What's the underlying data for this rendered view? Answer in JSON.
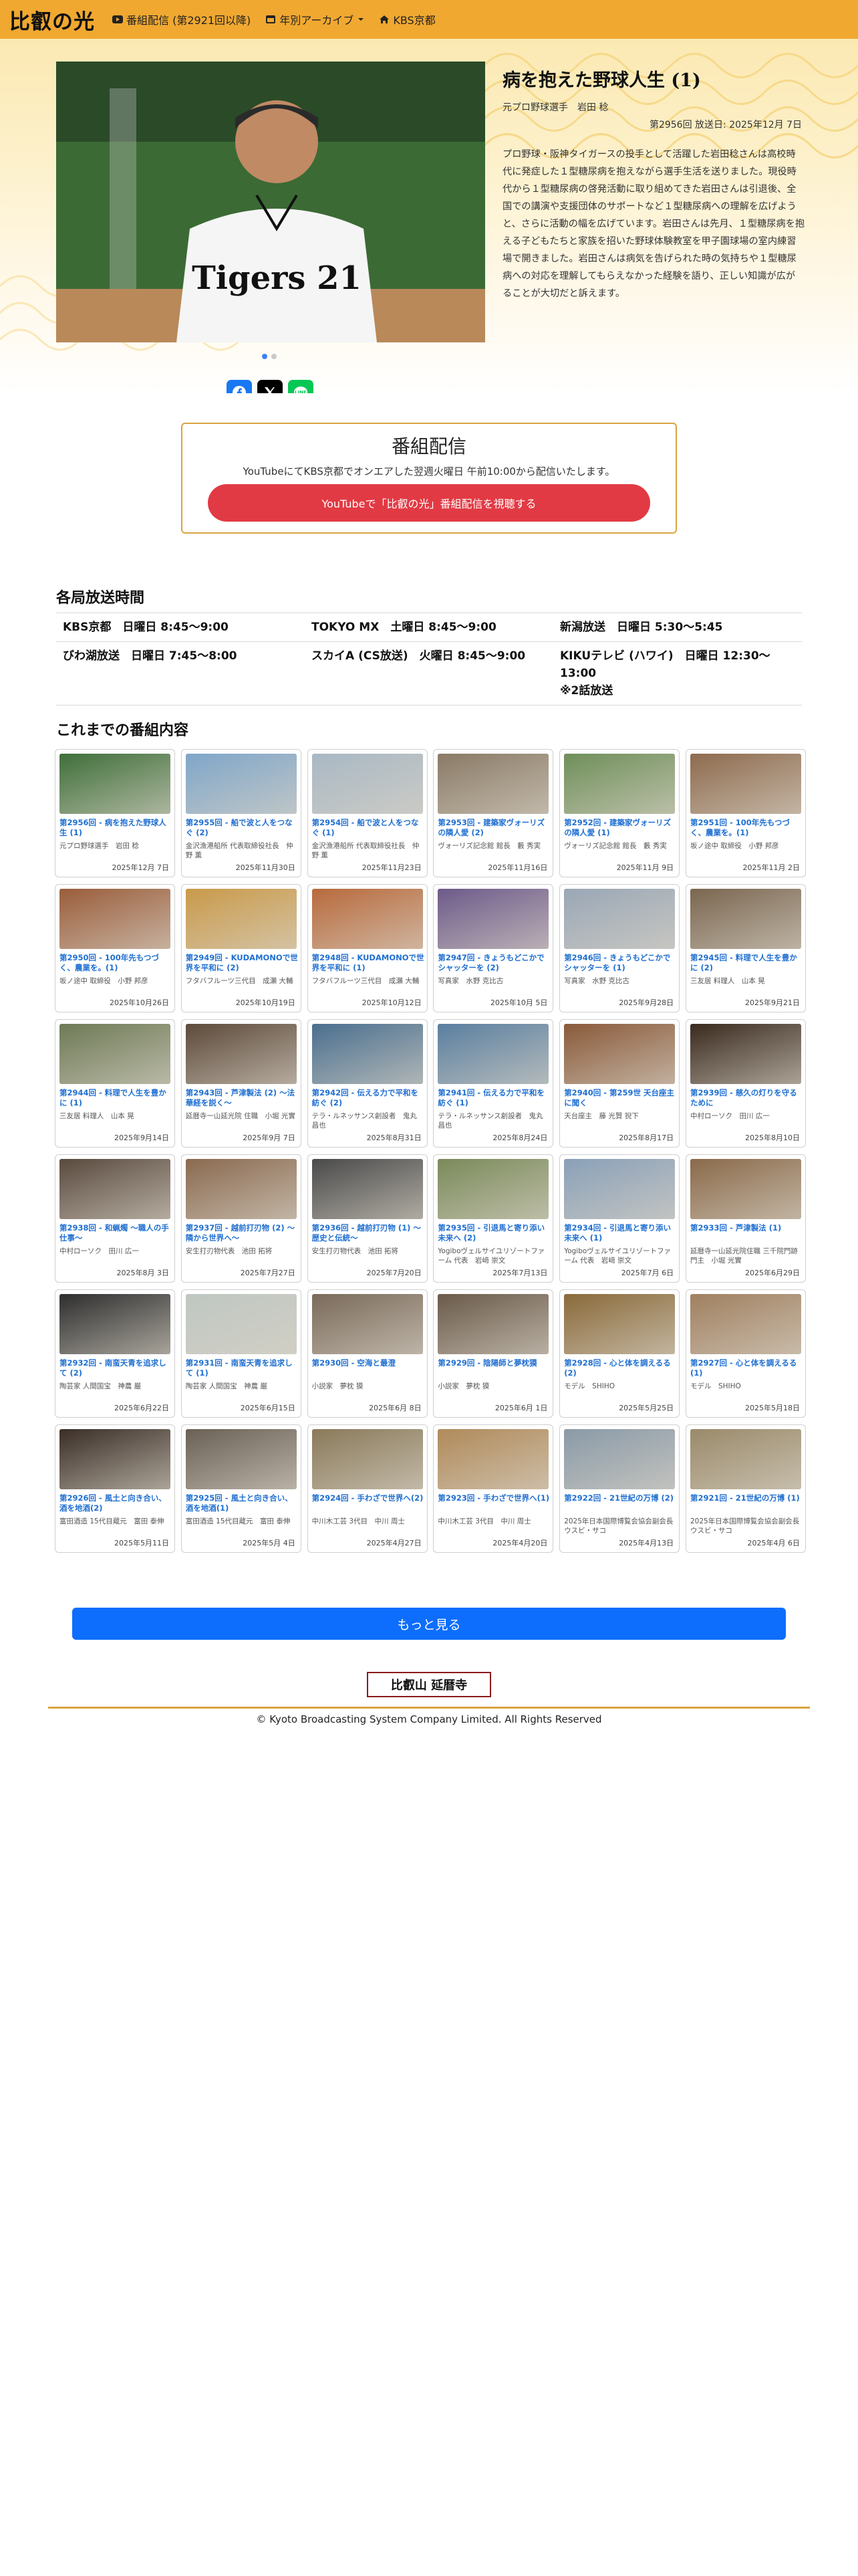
{
  "nav": {
    "brand": "比叡の光",
    "links": [
      {
        "label": "番組配信 (第2921回以降)",
        "icon": "youtube-icon"
      },
      {
        "label": "年別アーカイブ",
        "icon": "calendar-icon"
      },
      {
        "label": "KBS京都",
        "icon": "home-icon"
      }
    ]
  },
  "hero": {
    "title": "病を抱えた野球人生 (1)",
    "guest": "元プロ野球選手　岩田 稔",
    "date": "第2956回 放送日: 2025年12月 7日",
    "description": "プロ野球・阪神タイガースの投手として活躍した岩田稔さんは高校時代に発症した１型糖尿病を抱えながら選手生活を送りました。現役時代から１型糖尿病の啓発活動に取り組めてきた岩田さんは引退後、全国での講演や支援団体のサポートなど１型糖尿病への理解を広げようと、さらに活動の幅を広げています。岩田さんは先月、１型糖尿病を抱える子どもたちと家族を招いた野球体験教室を甲子園球場の室内練習場で開きました。岩田さんは病気を告げられた時の気持ちや１型糖尿病への対応を理解してもらえなかった経験を語り、正しい知識が広がることが大切だと訴えます。",
    "jersey_text": "Tigers 21"
  },
  "stream": {
    "heading": "番組配信",
    "text": "YouTubeにてKBS京都でオンエアした翌週火曜日 午前10:00から配信いたします。",
    "button": "YouTubeで「比叡の光」番組配信を視聴する"
  },
  "schedule": {
    "title": "各局放送時間",
    "rows": [
      [
        "KBS京都　日曜日 8:45〜9:00",
        "TOKYO MX　土曜日 8:45〜9:00",
        "新潟放送　日曜日 5:30〜5:45"
      ],
      [
        "びわ湖放送　日曜日 7:45〜8:00",
        "スカイA (CS放送)　火曜日 8:45〜9:00",
        "KIKUテレビ (ハワイ)　日曜日 12:30〜13:00\n※2話放送"
      ]
    ]
  },
  "programs": {
    "title": "これまでの番組内容",
    "items": [
      {
        "title": "第2956回 - 病を抱えた野球人生 (1)",
        "guest": "元プロ野球選手　岩田 稔",
        "date": "2025年12月 7日",
        "thumb": "#3f6f3a"
      },
      {
        "title": "第2955回 - 船で波と人をつなぐ (2)",
        "guest": "金沢漁港船所 代表取締役社長　仲野 薫",
        "date": "2025年11月30日",
        "thumb": "#7fa6c9"
      },
      {
        "title": "第2954回 - 船で波と人をつなぐ (1)",
        "guest": "金沢漁港船所 代表取締役社長　仲野 薫",
        "date": "2025年11月23日",
        "thumb": "#a9b8c4"
      },
      {
        "title": "第2953回 - 建築家ヴォーリズの隣人愛 (2)",
        "guest": "ヴォーリズ記念館 館長　藪 秀実",
        "date": "2025年11月16日",
        "thumb": "#8a7a66"
      },
      {
        "title": "第2952回 - 建築家ヴォーリズの隣人愛 (1)",
        "guest": "ヴォーリズ記念館 館長　藪 秀実",
        "date": "2025年11月 9日",
        "thumb": "#6f8f5a"
      },
      {
        "title": "第2951回 - 100年先もつづく、農業を。(1)",
        "guest": "坂ノ途中 取締役　小野 邦彦",
        "date": "2025年11月 2日",
        "thumb": "#8e6b4e"
      },
      {
        "title": "第2950回 - 100年先もつづく、農業を。(1)",
        "guest": "坂ノ途中 取締役　小野 邦彦",
        "date": "2025年10月26日",
        "thumb": "#9a5d3b"
      },
      {
        "title": "第2949回 - KUDAMONOで世界を平和に (2)",
        "guest": "フタバフルーツ三代目　成瀬 大輔",
        "date": "2025年10月19日",
        "thumb": "#c99a4a"
      },
      {
        "title": "第2948回 - KUDAMONOで世界を平和に (1)",
        "guest": "フタバフルーツ三代目　成瀬 大輔",
        "date": "2025年10月12日",
        "thumb": "#b86a3c"
      },
      {
        "title": "第2947回 - きょうもどこかでシャッターを (2)",
        "guest": "写真家　水野 克比古",
        "date": "2025年10月 5日",
        "thumb": "#6d5a8a"
      },
      {
        "title": "第2946回 - きょうもどこかでシャッターを (1)",
        "guest": "写真家　水野 克比古",
        "date": "2025年9月28日",
        "thumb": "#9aa7b6"
      },
      {
        "title": "第2945回 - 料理で人生を豊かに (2)",
        "guest": "三友居 料理人　山本 晃",
        "date": "2025年9月21日",
        "thumb": "#7a6650"
      },
      {
        "title": "第2944回 - 料理で人生を豊かに (1)",
        "guest": "三友居 料理人　山本 晃",
        "date": "2025年9月14日",
        "thumb": "#6e7a56"
      },
      {
        "title": "第2943回 - 芦津製法 (2) 〜法華経を説く〜",
        "guest": "延暦寺一山延光院 住職　小堀 光實",
        "date": "2025年9月 7日",
        "thumb": "#5d4a3a"
      },
      {
        "title": "第2942回 - 伝える力で平和を紡ぐ (2)",
        "guest": "テラ・ルネッサンス創設者　鬼丸 昌也",
        "date": "2025年8月31日",
        "thumb": "#4a6f8f"
      },
      {
        "title": "第2941回 - 伝える力で平和を紡ぐ (1)",
        "guest": "テラ・ルネッサンス創設者　鬼丸 昌也",
        "date": "2025年8月24日",
        "thumb": "#5a7fa0"
      },
      {
        "title": "第2940回 - 第259世 天台座主に聞く",
        "guest": "天台座主　藤 光賢 猊下",
        "date": "2025年8月17日",
        "thumb": "#8a5a3a"
      },
      {
        "title": "第2939回 - 慈久の灯りを守るために",
        "guest": "中村ローソク　田川 広一",
        "date": "2025年8月10日",
        "thumb": "#3a2a1e"
      },
      {
        "title": "第2938回 - 和蝋燭 〜職人の手仕事〜",
        "guest": "中村ローソク　田川 広一",
        "date": "2025年8月 3日",
        "thumb": "#5a4a3e"
      },
      {
        "title": "第2937回 - 越前打刃物 (2) 〜隣から世界へ〜",
        "guest": "安生打刃物代表　池田 拓将",
        "date": "2025年7月27日",
        "thumb": "#8a6a50"
      },
      {
        "title": "第2936回 - 越前打刃物 (1) 〜歴史と伝統〜",
        "guest": "安生打刃物代表　池田 拓将",
        "date": "2025年7月20日",
        "thumb": "#4a4a4a"
      },
      {
        "title": "第2935回 - 引退馬と寄り添い未来へ (2)",
        "guest": "Yogiboヴェルサイユリゾートファーム 代表　岩﨑 崇文",
        "date": "2025年7月13日",
        "thumb": "#7a8a5a"
      },
      {
        "title": "第2934回 - 引退馬と寄り添い未来へ (1)",
        "guest": "Yogiboヴェルサイユリゾートファーム 代表　岩﨑 崇文",
        "date": "2025年7月 6日",
        "thumb": "#8aa0b8"
      },
      {
        "title": "第2933回 - 芦津製法 (1)",
        "guest": "延暦寺一山延光院住職 三千院門跡門主　小堀 光實",
        "date": "2025年6月29日",
        "thumb": "#8a6a4a"
      },
      {
        "title": "第2932回 - 南蛮天青を追求して (2)",
        "guest": "陶芸家 人間国宝　神農 巌",
        "date": "2025年6月22日",
        "thumb": "#2e2e2e"
      },
      {
        "title": "第2931回 - 南蛮天青を追求して (1)",
        "guest": "陶芸家 人間国宝　神農 巌",
        "date": "2025年6月15日",
        "thumb": "#bfc7c2"
      },
      {
        "title": "第2930回 - 空海と最澄",
        "guest": "小説家　夢枕 獏",
        "date": "2025年6月 8日",
        "thumb": "#7a6a5a"
      },
      {
        "title": "第2929回 - 陰陽師と夢枕獏",
        "guest": "小説家　夢枕 獏",
        "date": "2025年6月 1日",
        "thumb": "#6a5a4a"
      },
      {
        "title": "第2928回 - 心と体を調えるる(2)",
        "guest": "モデル　SHIHO",
        "date": "2025年5月25日",
        "thumb": "#8a6a3a"
      },
      {
        "title": "第2927回 - 心と体を調えるる(1)",
        "guest": "モデル　SHIHO",
        "date": "2025年5月18日",
        "thumb": "#a08060"
      },
      {
        "title": "第2926回 - 風土と向き合い、酒を地酒(2)",
        "guest": "富田酒造 15代目蔵元　富田 泰伸",
        "date": "2025年5月11日",
        "thumb": "#3a2e26"
      },
      {
        "title": "第2925回 - 風土と向き合い、酒を地酒(1)",
        "guest": "富田酒造 15代目蔵元　富田 泰伸",
        "date": "2025年5月 4日",
        "thumb": "#6a6056"
      },
      {
        "title": "第2924回 - 手わざで世界へ(2)",
        "guest": "中川木工芸 3代目　中川 周士",
        "date": "2025年4月27日",
        "thumb": "#8a7a5a"
      },
      {
        "title": "第2923回 - 手わざで世界へ(1)",
        "guest": "中川木工芸 3代目　中川 周士",
        "date": "2025年4月20日",
        "thumb": "#b08a5a"
      },
      {
        "title": "第2922回 - 21世紀の万博 (2)",
        "guest": "2025年日本国際博覧会協会副会長　ウスビ・サコ",
        "date": "2025年4月13日",
        "thumb": "#8a9aa8"
      },
      {
        "title": "第2921回 - 21世紀の万博 (1)",
        "guest": "2025年日本国際博覧会協会副会長　ウスビ・サコ",
        "date": "2025年4月 6日",
        "thumb": "#9a8a6a"
      }
    ]
  },
  "more_button": "もっと見る",
  "sponsor": "比叡山 延暦寺",
  "copyright": "© Kyoto Broadcasting System Company Limited. All Rights Reserved",
  "colors": {
    "nav": "#f0a830",
    "accent_red": "#e23a44",
    "link_blue": "#1f6fd1",
    "primary": "#0d6efd",
    "gold": "#d9a441"
  }
}
